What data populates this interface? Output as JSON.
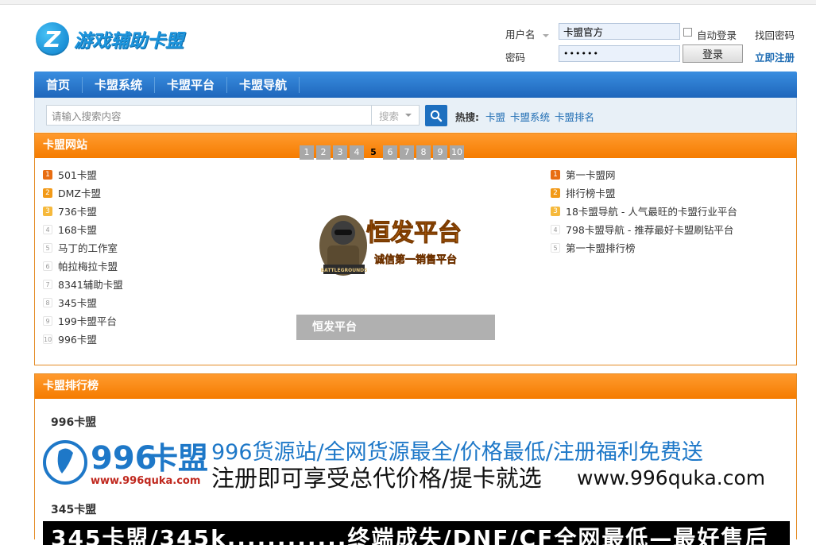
{
  "logo": {
    "mark": "Z",
    "text": "游戏辅助卡盟"
  },
  "login": {
    "username_label": "用户名",
    "username_value": "卡盟官方",
    "auto_login_label": "自动登录",
    "forgot_label": "找回密码",
    "password_label": "密码",
    "password_value": "••••••",
    "login_button": "登录",
    "register_label": "立即注册"
  },
  "nav": {
    "items": [
      "首页",
      "卡盟系统",
      "卡盟平台",
      "卡盟导航"
    ]
  },
  "search": {
    "placeholder": "请输入搜索内容",
    "select_value": "搜索",
    "hot_label": "热搜:",
    "hot_links": [
      "卡盟",
      "卡盟系统",
      "卡盟排名"
    ]
  },
  "sites_panel": {
    "title": "卡盟网站",
    "left_list": [
      {
        "rank": "1",
        "name": "501卡盟"
      },
      {
        "rank": "2",
        "name": "DMZ卡盟"
      },
      {
        "rank": "3",
        "name": "736卡盟"
      },
      {
        "rank": "4",
        "name": "168卡盟"
      },
      {
        "rank": "5",
        "name": "马丁的工作室"
      },
      {
        "rank": "6",
        "name": "帕拉梅拉卡盟"
      },
      {
        "rank": "7",
        "name": "8341辅助卡盟"
      },
      {
        "rank": "8",
        "name": "345卡盟"
      },
      {
        "rank": "9",
        "name": "199卡盟平台"
      },
      {
        "rank": "10",
        "name": "996卡盟"
      }
    ],
    "pages": [
      "1",
      "2",
      "3",
      "4",
      "5",
      "6",
      "7",
      "8",
      "9",
      "10"
    ],
    "active_page": "5",
    "slide": {
      "title": "恒发平台",
      "subtitle": "诚信第一销售平台",
      "game_logo_text": "BATTLEGROUNDS",
      "caption": "恒发平台"
    },
    "right_list": [
      {
        "rank": "1",
        "name": "第一卡盟网"
      },
      {
        "rank": "2",
        "name": "排行榜卡盟"
      },
      {
        "rank": "3",
        "name": "18卡盟导航 - 人气最旺的卡盟行业平台"
      },
      {
        "rank": "4",
        "name": "798卡盟导航 - 推荐最好卡盟刷钻平台"
      },
      {
        "rank": "5",
        "name": "第一卡盟排行榜"
      }
    ]
  },
  "ranking_panel": {
    "title": "卡盟排行榜",
    "entries": [
      {
        "name": "996卡盟",
        "banner": {
          "logo_number": "996",
          "logo_word": "卡盟",
          "logo_url": "www.996quka.com",
          "line1": "996货源站/全网货源最全/价格最低/注册福利免费送",
          "line2_a": "注册即可享受总代价格/提卡就选",
          "line2_b": "www.996quka.com"
        }
      },
      {
        "name": "345卡盟",
        "banner": {
          "line1": "345卡盟/345k............终端成失/DNF/CF全网最低—最好售后"
        }
      }
    ]
  },
  "colors": {
    "nav_blue": "#1e66bb",
    "panel_orange": "#f57c00",
    "link_blue": "#1e6cb3"
  }
}
